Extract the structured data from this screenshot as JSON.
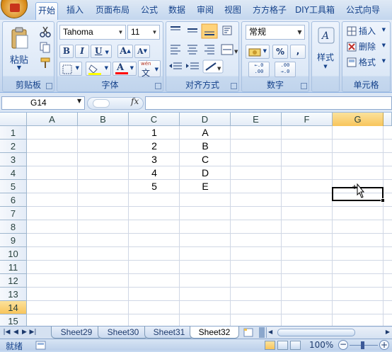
{
  "ribbon": {
    "tabs": [
      "开始",
      "插入",
      "页面布局",
      "公式",
      "数据",
      "审阅",
      "视图",
      "方方格子",
      "DIY工具箱",
      "公式向导"
    ],
    "active_tab": "开始",
    "clipboard": {
      "paste_label": "粘贴",
      "group_label": "剪贴板"
    },
    "font": {
      "name": "Tahoma",
      "size": "11",
      "bold": "B",
      "italic": "I",
      "underline": "U",
      "grow": "A",
      "shrink": "A",
      "font_color_letter": "A",
      "phonetic_top": "wén",
      "phonetic_bottom": "文",
      "fill_color": "#ffff00",
      "font_color": "#ff0000",
      "group_label": "字体"
    },
    "alignment": {
      "group_label": "对齐方式"
    },
    "number": {
      "format": "常规",
      "percent": "%",
      "comma": ",",
      "inc_dec_top": "←.0",
      "inc_dec_bottom": ".00",
      "dec_dec_top": ".00",
      "dec_dec_bottom": "→.0",
      "group_label": "数字"
    },
    "styles": {
      "label": "样式"
    },
    "cells": {
      "insert": "插入",
      "delete": "删除",
      "format": "格式",
      "group_label": "单元格"
    }
  },
  "formula_bar": {
    "name_box": "G14",
    "fx": "fx",
    "formula": ""
  },
  "grid": {
    "columns": [
      "A",
      "B",
      "C",
      "D",
      "E",
      "F",
      "G"
    ],
    "selected_column": "G",
    "rows": [
      "1",
      "2",
      "3",
      "4",
      "5",
      "6",
      "7",
      "8",
      "9",
      "10",
      "11",
      "12",
      "13",
      "14",
      "15"
    ],
    "selected_row": "14",
    "cells": {
      "C": [
        "1",
        "2",
        "3",
        "4",
        "5"
      ],
      "D": [
        "A",
        "B",
        "C",
        "D",
        "E"
      ]
    }
  },
  "sheets": {
    "tabs": [
      "Sheet29",
      "Sheet30",
      "Sheet31",
      "Sheet32"
    ],
    "active": "Sheet32"
  },
  "status": {
    "ready": "就绪",
    "zoom": "100%"
  },
  "colors": {
    "accent": "#15428b",
    "selection_header": "#f8c55c",
    "ribbon_bg": "#dbe7f6"
  }
}
